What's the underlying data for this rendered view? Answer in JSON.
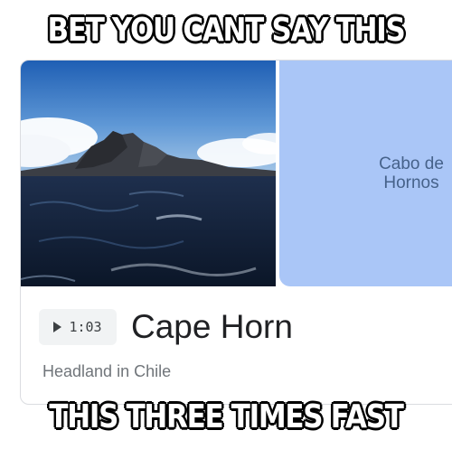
{
  "meme": {
    "top_text": "BET YOU CANT SAY THIS",
    "bottom_text": "THIS THREE TIMES FAST"
  },
  "card": {
    "map_label": "Cabo de Hornos",
    "audio_duration": "1:03",
    "title": "Cape Horn",
    "subtitle": "Headland in Chile"
  },
  "colors": {
    "map_water": "#aac6f7",
    "title_text": "#202124",
    "subtitle_text": "#70757a"
  },
  "icons": {
    "audio": "play-icon"
  }
}
